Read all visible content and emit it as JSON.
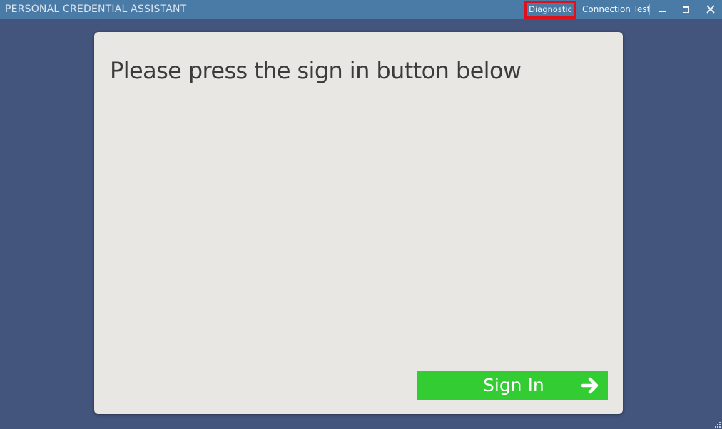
{
  "window": {
    "title": "PERSONAL CREDENTIAL ASSISTANT",
    "links": {
      "diagnostic": "Diagnostic",
      "connection_test": "Connection Test"
    },
    "controls": {
      "minimize_icon": "minimize-icon",
      "maximize_icon": "maximize-icon",
      "close_icon": "close-icon"
    }
  },
  "main": {
    "prompt": "Please press the sign in button below",
    "sign_in_button": {
      "label": "Sign In",
      "icon": "arrow-right-icon"
    }
  },
  "colors": {
    "titlebar": "#4a7aa6",
    "background": "#43547d",
    "card": "#e9e7e4",
    "accent_green": "#33cc33",
    "highlight_red": "#e0101a"
  }
}
